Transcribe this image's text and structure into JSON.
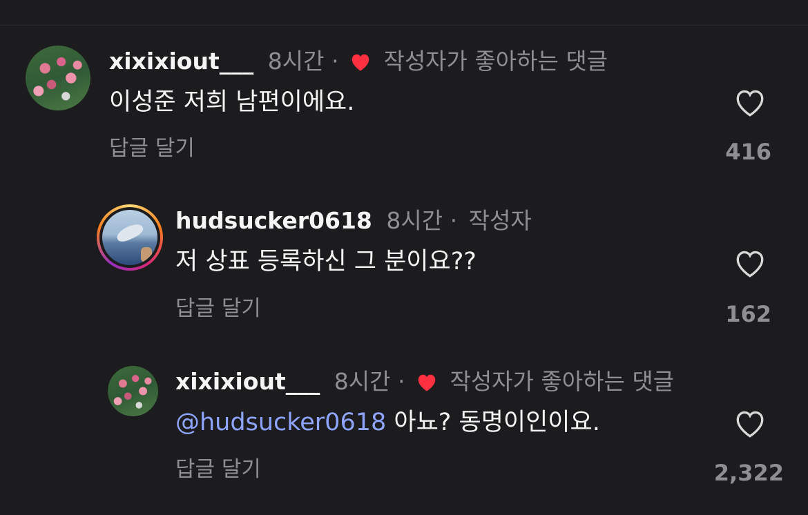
{
  "comments": [
    {
      "username": "xixixiout___",
      "time": "8시간",
      "separator": "·",
      "liked_by_author": "작성자가 좋아하는 댓글",
      "text": "이성준 저희 남편이에요.",
      "reply_label": "답글 달기",
      "likes": "416"
    },
    {
      "username": "hudsucker0618",
      "time": "8시간",
      "separator": "·",
      "author_tag": "작성자",
      "text": "저 상표 등록하신 그 분이요??",
      "reply_label": "답글 달기",
      "likes": "162"
    },
    {
      "username": "xixixiout___",
      "time": "8시간",
      "separator": "·",
      "liked_by_author": "작성자가 좋아하는 댓글",
      "mention": "@hudsucker0618",
      "text": " 아뇨? 동명이인이요.",
      "reply_label": "답글 달기",
      "likes": "2,322"
    }
  ],
  "icons": {
    "like": "heart-outline-icon",
    "author_like": "heart-filled-icon"
  },
  "colors": {
    "background": "#1c1c1e",
    "muted": "#8e8e93",
    "mention": "#8ea4ff",
    "heart": "#ff3040"
  }
}
